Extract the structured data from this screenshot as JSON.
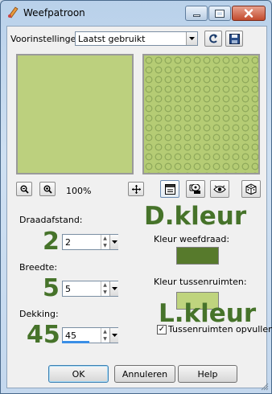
{
  "window": {
    "title": "Weefpatroon",
    "controls": [
      "minimize-icon",
      "maximize-icon",
      "close-icon"
    ]
  },
  "presets": {
    "label": "Voorinstellingen:",
    "value": "Laatst gebruikt"
  },
  "zoom": {
    "level": "100%"
  },
  "fields": {
    "gap": {
      "label": "Draadafstand:",
      "value": "2",
      "overlay": "2"
    },
    "width": {
      "label": "Breedte:",
      "value": "5",
      "overlay": "5"
    },
    "opacity": {
      "label": "Dekking:",
      "value": "45",
      "overlay": "45",
      "progress": 0.45
    }
  },
  "colors": {
    "thread_label": "Kleur weefdraad:",
    "thread_color": "#577a2c",
    "gap_label": "Kleur tussenruimten:",
    "gap_color": "#bfd47e",
    "overlay_dark": "D.kleur",
    "overlay_light": "L.kleur",
    "fill_gaps_label": "Tussenruimten opvullen",
    "fill_gaps_checked": true
  },
  "buttons": {
    "ok": "OK",
    "cancel": "Annuleren",
    "help": "Help"
  }
}
